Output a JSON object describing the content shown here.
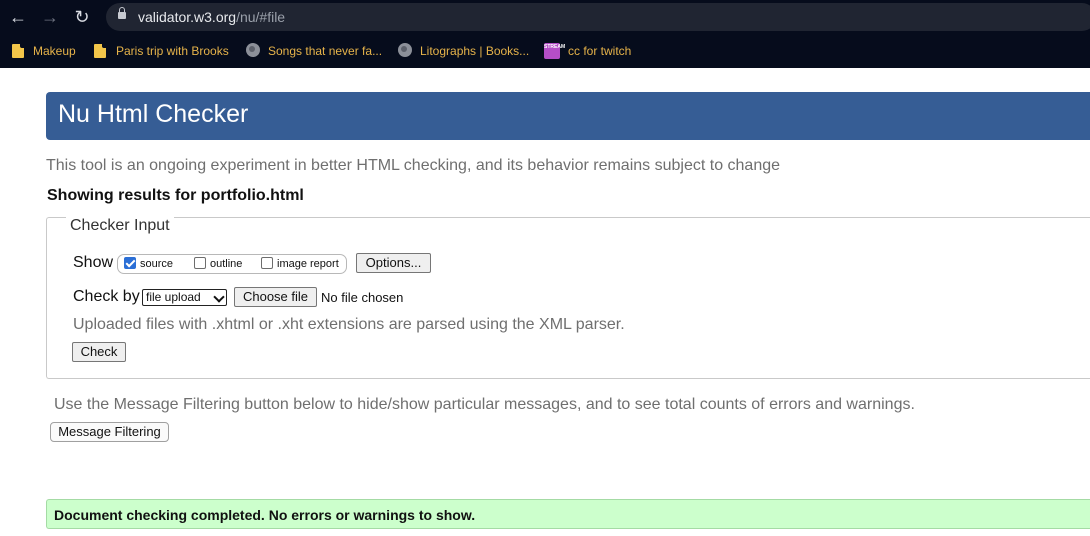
{
  "browser": {
    "url_host": "validator.w3.org",
    "url_path": "/nu/#file",
    "bookmarks": [
      {
        "label": "Makeup",
        "icon": "folder-icon"
      },
      {
        "label": "Paris trip with Brooks",
        "icon": "folder-icon"
      },
      {
        "label": "Songs that never fa...",
        "icon": "globe-icon"
      },
      {
        "label": "Litographs | Books...",
        "icon": "globe-icon"
      },
      {
        "label": "cc for twitch",
        "icon": "stream-icon"
      }
    ],
    "stream_icon_text": "STREAM"
  },
  "page": {
    "title": "Nu Html Checker",
    "tagline": "This tool is an ongoing experiment in better HTML checking, and its behavior remains subject to change",
    "results_for": "Showing results for portfolio.html",
    "checker": {
      "legend": "Checker Input",
      "show_label": "Show",
      "show_options": [
        {
          "label": "source",
          "checked": true
        },
        {
          "label": "outline",
          "checked": false
        },
        {
          "label": "image report",
          "checked": false
        }
      ],
      "options_button": "Options...",
      "check_by_label": "Check by",
      "check_by_value": "file upload",
      "choose_file_button": "Choose file",
      "file_status": "No file chosen",
      "xml_hint": "Uploaded files with .xhtml or .xht extensions are parsed using the XML parser.",
      "check_button": "Check"
    },
    "filter_hint": "Use the Message Filtering button below to hide/show particular messages, and to see total counts of errors and warnings.",
    "filter_button": "Message Filtering",
    "success_message": "Document checking completed. No errors or warnings to show."
  },
  "colors": {
    "chrome_bg": "#060c1c",
    "header_blue": "#365d95",
    "success_green": "#ccffcc"
  }
}
